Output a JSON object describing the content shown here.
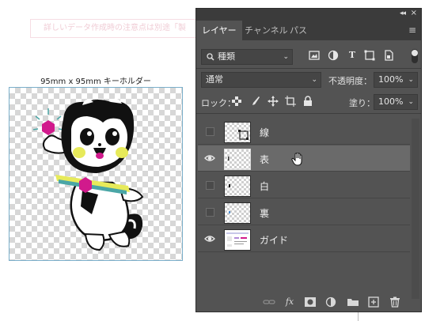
{
  "banner": {
    "text": "詳しいデータ作成時の注意点は別途「製"
  },
  "artboard": {
    "title": "95mm x 95mm キーホルダー"
  },
  "panel": {
    "tabs": [
      {
        "label": "レイヤー",
        "active": true
      },
      {
        "label": "チャンネル",
        "active": false
      },
      {
        "label": "パス",
        "active": false
      }
    ],
    "filter": {
      "value": "種類"
    },
    "blend_mode": {
      "value": "通常"
    },
    "opacity": {
      "label": "不透明度：",
      "value": "100%"
    },
    "lock": {
      "label": "ロック："
    },
    "fill": {
      "label": "塗り：",
      "value": "100%"
    },
    "layers": [
      {
        "name": "線",
        "visible": false,
        "selected": false
      },
      {
        "name": "表",
        "visible": true,
        "selected": true
      },
      {
        "name": "白",
        "visible": false,
        "selected": false
      },
      {
        "name": "裏",
        "visible": false,
        "selected": false
      },
      {
        "name": "ガイド",
        "visible": true,
        "selected": false
      }
    ],
    "footer_icons": [
      "link-icon",
      "fx-icon",
      "mask-icon",
      "adjustment-icon",
      "folder-icon",
      "new-layer-icon",
      "trash-icon"
    ]
  },
  "colors": {
    "panel_bg": "#535353",
    "selected_layer": "#6a6a6a",
    "magenta": "#d11a8c",
    "teal": "#4aa6a6"
  }
}
